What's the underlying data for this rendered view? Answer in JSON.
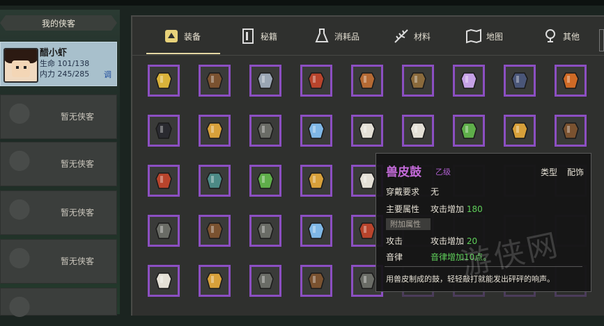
{
  "left_panel": {
    "header": "我的侠客",
    "hero": {
      "name": "醋小虾",
      "hp_label": "生命",
      "hp_value": "101/138",
      "mp_label": "内力",
      "mp_value": "245/285",
      "tag": "调"
    },
    "empty_label": "暂无侠客"
  },
  "tabs": [
    {
      "label": "装备",
      "icon": "equipment-icon"
    },
    {
      "label": "秘籍",
      "icon": "book-icon"
    },
    {
      "label": "消耗品",
      "icon": "potion-icon"
    },
    {
      "label": "材料",
      "icon": "herb-icon"
    },
    {
      "label": "地图",
      "icon": "map-icon"
    },
    {
      "label": "其他",
      "icon": "misc-icon"
    }
  ],
  "grid_rows": [
    [
      "robe-yellow",
      "vest-brown",
      "armor-silver",
      "robe-red",
      "armor-copper",
      "armor-leather",
      "robe-violet",
      "robe-indigo",
      "robe-orange"
    ],
    [
      "cloak-black",
      "robe-gold",
      "bracer-gray",
      "shoe-blue",
      "fan-white",
      "pouch-white",
      "gourd-green",
      "ginseng-gold",
      "feather-brown"
    ],
    [
      "beads-red",
      "wrap-teal",
      "jade-green",
      "pouch-gold",
      "pearl-white",
      "",
      "",
      "",
      ""
    ],
    [
      "bag-gray",
      "necklace-brown",
      "pot-gray",
      "hat-blue",
      "scroll-red",
      "",
      "",
      "",
      ""
    ],
    [
      "stone-white",
      "bell-gold",
      "shield-gray",
      "jar-brown",
      "pipe-gray",
      "",
      "",
      "",
      ""
    ]
  ],
  "tooltip": {
    "name": "兽皮鼓",
    "grade": "乙级",
    "type_label": "类型",
    "type_value": "配饰",
    "req_label": "穿戴要求",
    "req_value": "无",
    "main_label": "主要属性",
    "main_text": "攻击增加",
    "main_value": "180",
    "sub_header": "附加属性",
    "attack_label": "攻击",
    "attack_text": "攻击增加",
    "attack_value": "20",
    "music_label": "音律",
    "music_text": "音律增加10点。",
    "description": "用兽皮制成的鼓，轻轻敲打就能发出砰砰的响声。"
  },
  "watermark": "游侠网",
  "colors": {
    "rare_border": "#8c4fc2",
    "grade_purple": "#c36ad9",
    "bonus_green": "#5fcf5a"
  }
}
